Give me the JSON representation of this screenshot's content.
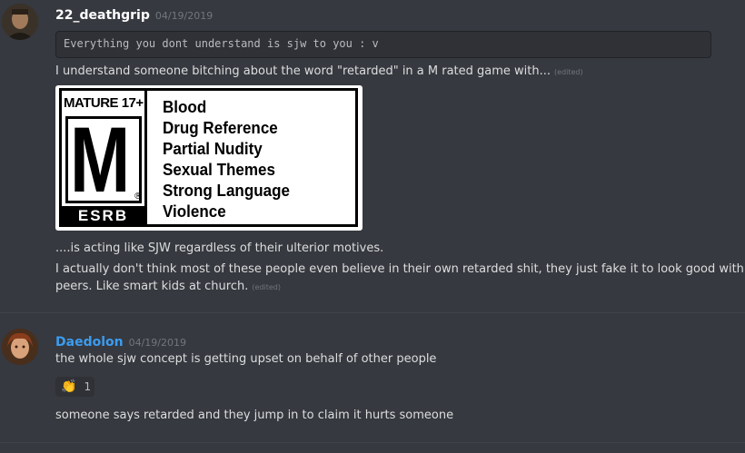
{
  "messages": [
    {
      "username": "22_deathgrip",
      "username_color": "#ffffff",
      "timestamp": "04/19/2019",
      "code_block": "Everything you dont understand is sjw to you : v",
      "line1": "I understand someone bitching about the word \"retarded\" in a M rated game with...",
      "edited1": "(edited)",
      "image": {
        "rating": "MATURE 17+",
        "letter": "M",
        "registered": "®",
        "brand": "ESRB",
        "descriptors": [
          "Blood",
          "Drug Reference",
          "Partial Nudity",
          "Sexual Themes",
          "Strong Language",
          "Violence"
        ]
      },
      "line2": "....is acting like SJW regardless of their ulterior motives.",
      "line3a": "I actually don't think most of these people even believe in their own retarded shit, they just fake it to look good with their",
      "line3b": "peers. Like smart kids at church.",
      "edited2": "(edited)"
    },
    {
      "username": "Daedolon",
      "username_color": "#3b9cf1",
      "timestamp": "04/19/2019",
      "line1": "the whole sjw concept is getting upset on behalf of other people",
      "reaction": {
        "emoji": "👏",
        "emoji_name": "clap-emoji",
        "count": "1"
      },
      "line2": "someone says retarded and they jump in to claim it hurts someone"
    }
  ]
}
